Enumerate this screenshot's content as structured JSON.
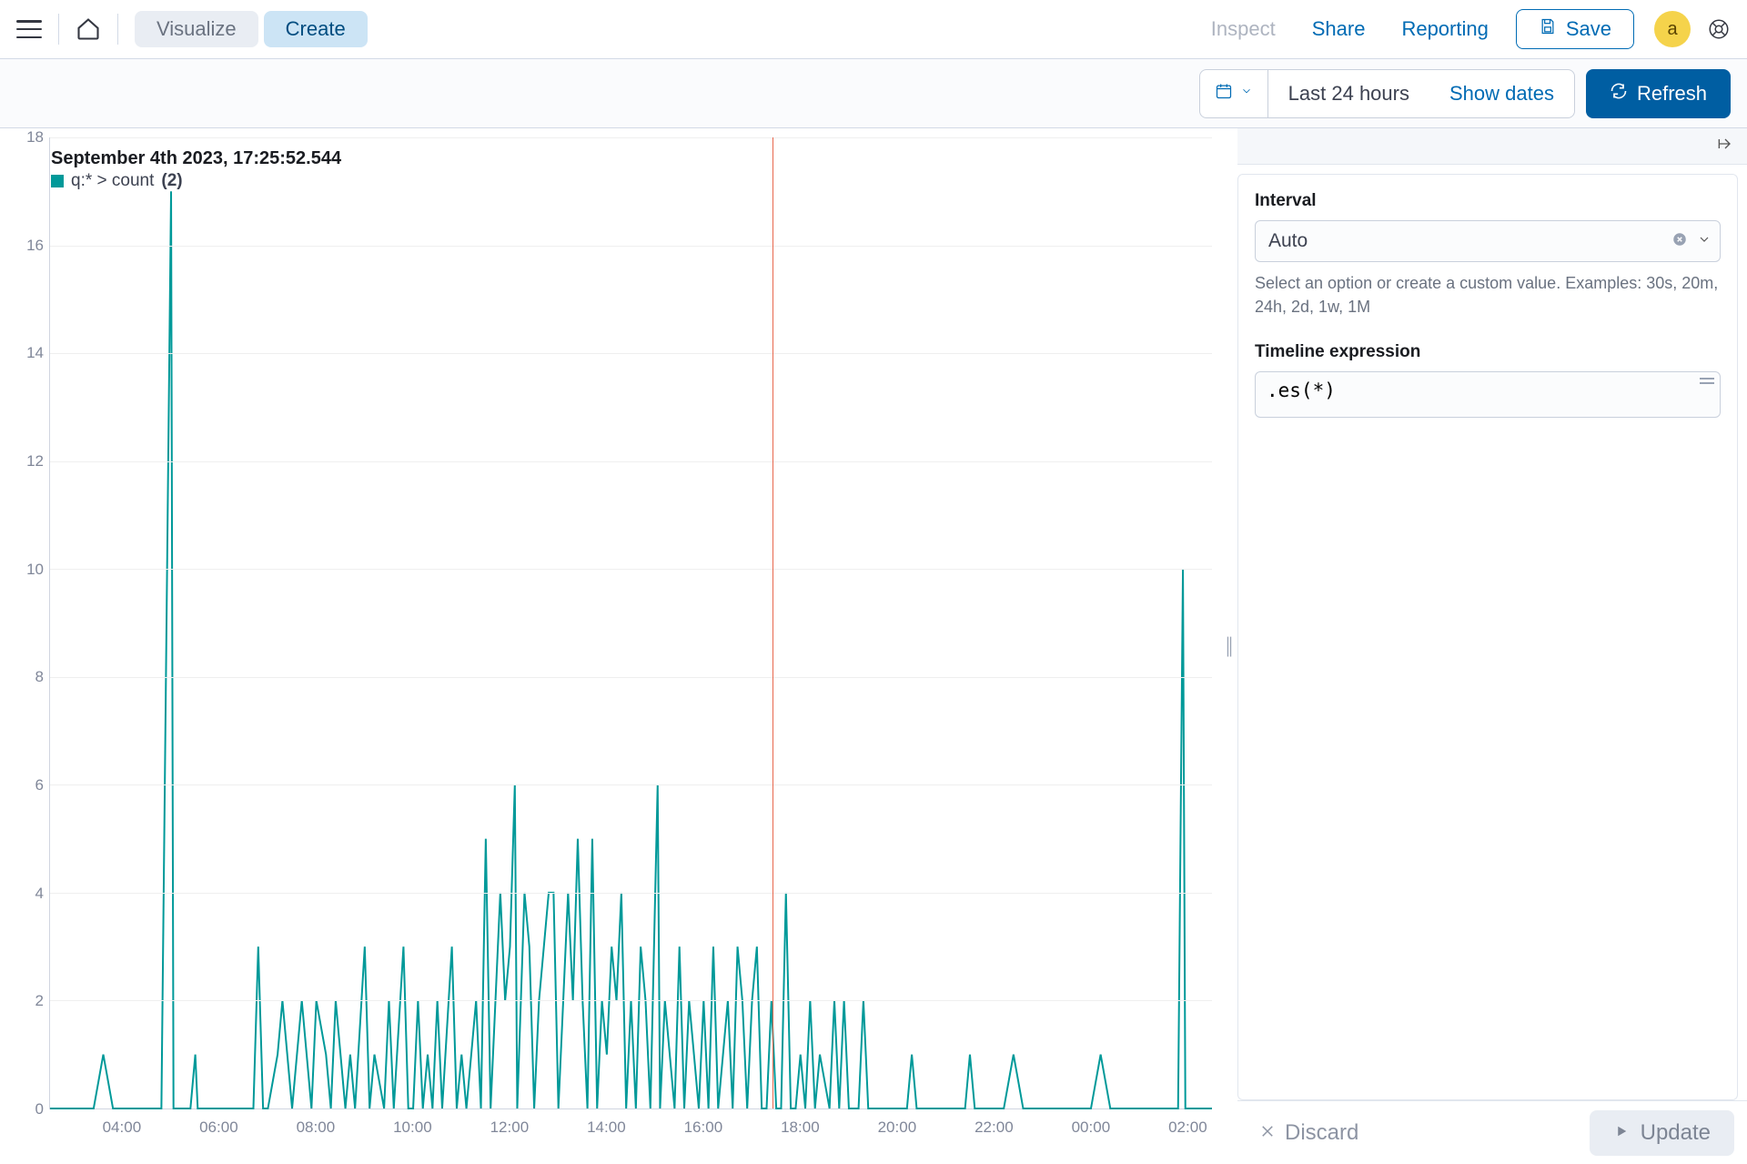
{
  "appbar": {
    "tabs": {
      "visualize": "Visualize",
      "create": "Create"
    },
    "inspect": "Inspect",
    "share": "Share",
    "reporting": "Reporting",
    "save": "Save",
    "avatar_initial": "a"
  },
  "querybar": {
    "range": "Last 24 hours",
    "show_dates": "Show dates",
    "refresh": "Refresh"
  },
  "tooltip": {
    "time": "September 4th 2023, 17:25:52.544",
    "series_label": "q:* > count",
    "value": "(2)"
  },
  "sidebar": {
    "interval_label": "Interval",
    "interval_value": "Auto",
    "interval_help": "Select an option or create a custom value. Examples: 30s, 20m, 24h, 2d, 1w, 1M",
    "expression_label": "Timeline expression",
    "expression_value": ".es(*)",
    "discard": "Discard",
    "update": "Update"
  },
  "chart_data": {
    "type": "line",
    "title": "",
    "xlabel": "",
    "ylabel": "",
    "ylim": [
      0,
      18
    ],
    "yticks": [
      0,
      2,
      4,
      6,
      8,
      10,
      12,
      14,
      16,
      18
    ],
    "x_tick_labels": [
      "04:00",
      "06:00",
      "08:00",
      "10:00",
      "12:00",
      "14:00",
      "16:00",
      "18:00",
      "20:00",
      "22:00",
      "00:00",
      "02:00"
    ],
    "x_tick_positions_hours": [
      4,
      6,
      8,
      10,
      12,
      14,
      16,
      18,
      20,
      22,
      24,
      26
    ],
    "x_range_hours": [
      2.5,
      26.5
    ],
    "crosshair_hour": 17.43,
    "crosshair_value": 2,
    "series": [
      {
        "name": "q:* > count",
        "color": "#009999",
        "x_hours": [
          2.5,
          2.8,
          3.1,
          3.4,
          3.6,
          3.8,
          4.0,
          4.2,
          4.4,
          4.6,
          4.8,
          5.0,
          5.05,
          5.1,
          5.2,
          5.4,
          5.5,
          5.55,
          5.7,
          5.9,
          6.1,
          6.3,
          6.5,
          6.7,
          6.8,
          6.9,
          7.0,
          7.2,
          7.3,
          7.5,
          7.6,
          7.7,
          7.8,
          7.9,
          8.0,
          8.2,
          8.3,
          8.4,
          8.6,
          8.7,
          8.8,
          9.0,
          9.1,
          9.2,
          9.4,
          9.5,
          9.6,
          9.8,
          9.9,
          10.0,
          10.1,
          10.2,
          10.3,
          10.4,
          10.5,
          10.6,
          10.8,
          10.9,
          11.0,
          11.1,
          11.3,
          11.4,
          11.5,
          11.6,
          11.8,
          11.9,
          12.0,
          12.1,
          12.15,
          12.3,
          12.4,
          12.5,
          12.6,
          12.7,
          12.8,
          12.9,
          13.0,
          13.1,
          13.2,
          13.3,
          13.4,
          13.5,
          13.6,
          13.7,
          13.8,
          13.9,
          14.0,
          14.1,
          14.2,
          14.3,
          14.4,
          14.5,
          14.6,
          14.7,
          14.8,
          14.9,
          15.05,
          15.1,
          15.2,
          15.3,
          15.4,
          15.5,
          15.6,
          15.7,
          15.8,
          15.9,
          16.0,
          16.1,
          16.2,
          16.3,
          16.4,
          16.5,
          16.6,
          16.7,
          16.8,
          16.9,
          17.0,
          17.1,
          17.2,
          17.3,
          17.4,
          17.5,
          17.6,
          17.7,
          17.8,
          17.9,
          18.0,
          18.1,
          18.2,
          18.3,
          18.4,
          18.6,
          18.7,
          18.8,
          18.9,
          19.0,
          19.2,
          19.3,
          19.4,
          19.6,
          19.8,
          20.0,
          20.2,
          20.3,
          20.4,
          20.6,
          20.8,
          21.0,
          21.2,
          21.4,
          21.5,
          21.6,
          21.8,
          22.0,
          22.2,
          22.4,
          22.6,
          22.8,
          23.0,
          23.2,
          23.4,
          23.6,
          23.8,
          24.0,
          24.2,
          24.4,
          24.6,
          24.8,
          25.0,
          25.2,
          25.4,
          25.6,
          25.8,
          25.9,
          25.95,
          26.0,
          26.2,
          26.4,
          26.5
        ],
        "values": [
          0,
          0,
          0,
          0,
          1,
          0,
          0,
          0,
          0,
          0,
          0,
          17,
          0,
          0,
          0,
          0,
          1,
          0,
          0,
          0,
          0,
          0,
          0,
          0,
          3,
          0,
          0,
          1,
          2,
          0,
          1,
          2,
          1,
          0,
          2,
          1,
          0,
          2,
          0,
          1,
          0,
          3,
          0,
          1,
          0,
          2,
          0,
          3,
          0,
          0,
          2,
          0,
          1,
          0,
          2,
          0,
          3,
          0,
          1,
          0,
          2,
          0,
          5,
          0,
          4,
          2,
          3,
          6,
          0,
          4,
          3,
          0,
          2,
          3,
          4,
          4,
          0,
          2,
          4,
          2,
          5,
          2,
          0,
          5,
          0,
          2,
          1,
          3,
          2,
          4,
          0,
          2,
          0,
          3,
          2,
          0,
          6,
          0,
          2,
          1,
          0,
          3,
          0,
          2,
          1,
          0,
          2,
          0,
          3,
          0,
          1,
          2,
          0,
          3,
          2,
          0,
          2,
          3,
          0,
          0,
          2,
          0,
          0,
          4,
          0,
          0,
          1,
          0,
          2,
          0,
          1,
          0,
          2,
          0,
          2,
          0,
          0,
          2,
          0,
          0,
          0,
          0,
          0,
          1,
          0,
          0,
          0,
          0,
          0,
          0,
          1,
          0,
          0,
          0,
          0,
          1,
          0,
          0,
          0,
          0,
          0,
          0,
          0,
          0,
          1,
          0,
          0,
          0,
          0,
          0,
          0,
          0,
          0,
          10,
          0,
          0,
          0,
          0,
          0
        ]
      }
    ]
  }
}
